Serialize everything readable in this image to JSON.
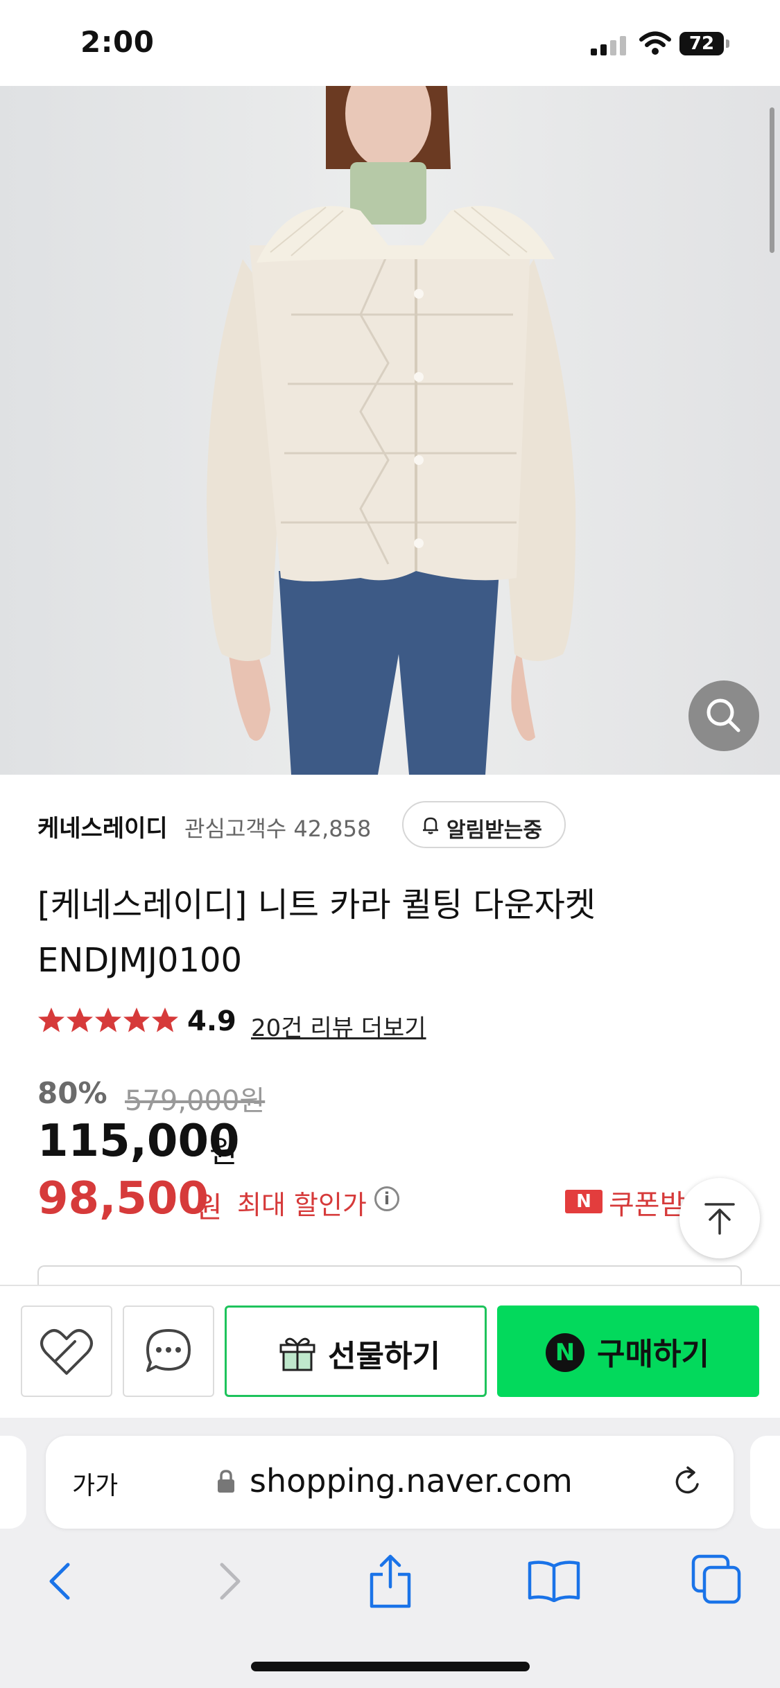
{
  "status_bar": {
    "time": "2:00",
    "battery": "72",
    "signal_icon": "cellular-signal-icon",
    "wifi_icon": "wifi-icon"
  },
  "gallery": {
    "image_count": 6,
    "active_index": 0,
    "zoom_icon": "magnifier-icon"
  },
  "seller": {
    "name": "케네스레이디",
    "followers_label": "관심고객수 42,858",
    "alarm_label": "알림받는중",
    "alarm_icon": "bell-icon"
  },
  "product": {
    "title": "[케네스레이디] 니트 카라 퀼팅 다운자켓 ENDJMJ0100"
  },
  "rating": {
    "stars": 5,
    "value": "4.9",
    "review_link": "20건 리뷰 더보기",
    "star_color": "#d63a3a"
  },
  "price": {
    "discount_rate": "80%",
    "original": "579,000원",
    "sale": "115,000",
    "sale_unit": "원",
    "max_discount_price": "98,500",
    "max_discount_unit": "원",
    "max_discount_label": "최대 할인가",
    "info_icon": "i",
    "coupon_badge": "N",
    "coupon_label": "쿠폰받기"
  },
  "scroll_top_icon": "arrow-up-icon",
  "actions": {
    "like_icon": "heart-icon",
    "chat_icon": "chat-bubble-icon",
    "gift_label": "선물하기",
    "gift_icon": "gift-icon",
    "buy_badge": "N",
    "buy_label": "구매하기",
    "buy_color": "#03d95c",
    "gift_border_color": "#1ec35c"
  },
  "browser": {
    "text_size_label": "가가",
    "url": "shopping.naver.com",
    "lock_icon": "lock-icon",
    "reload_icon": "reload-icon",
    "toolbar_icons": [
      "back-icon",
      "forward-icon",
      "share-icon",
      "bookmarks-icon",
      "tabs-icon"
    ]
  }
}
